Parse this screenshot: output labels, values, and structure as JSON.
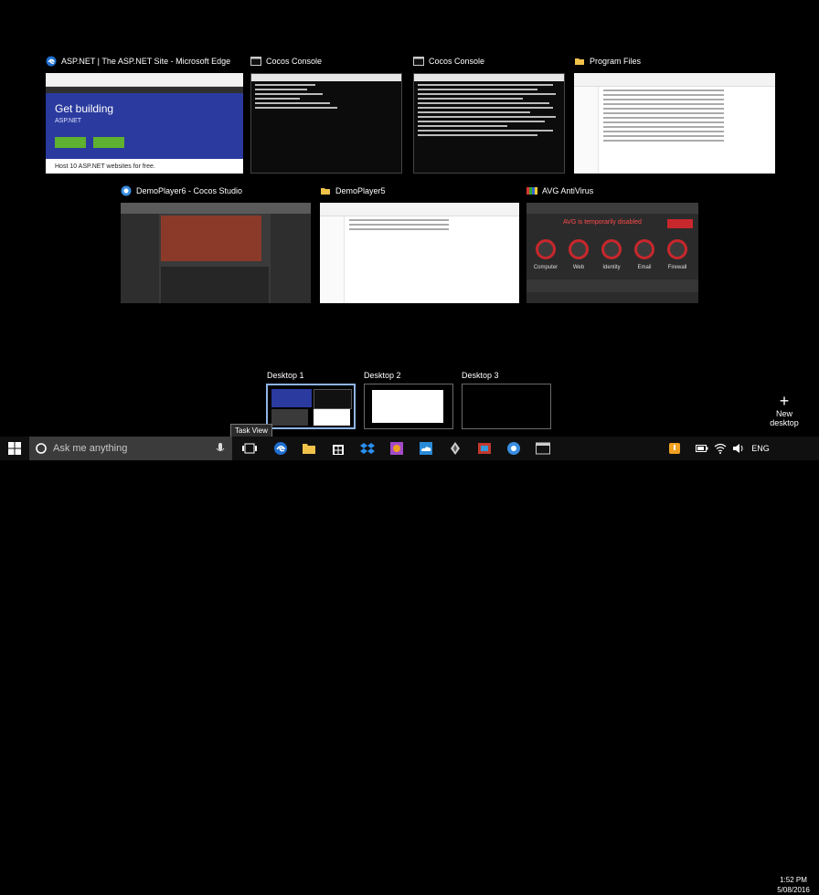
{
  "windows": [
    {
      "title": "ASP.NET | The ASP.NET Site - Microsoft Edge",
      "icon": "edge-icon",
      "thumb": {
        "hero_title": "Get building",
        "hero_subtitle": "ASP.NET",
        "footer_text": "Host 10 ASP.NET websites for free."
      }
    },
    {
      "title": "Cocos Console",
      "icon": "console-icon"
    },
    {
      "title": "Cocos Console",
      "icon": "console-icon"
    },
    {
      "title": "Program Files",
      "icon": "folder-icon"
    },
    {
      "title": "DemoPlayer6 - Cocos Studio",
      "icon": "cocos-studio-icon"
    },
    {
      "title": "DemoPlayer5",
      "icon": "folder-icon"
    },
    {
      "title": "AVG AntiVirus",
      "icon": "avg-icon",
      "thumb": {
        "alert": "AVG is temporarily disabled",
        "labels": [
          "Computer",
          "Web",
          "Identity",
          "Email",
          "Firewall"
        ]
      }
    }
  ],
  "desktops": [
    {
      "label": "Desktop 1",
      "selected": true
    },
    {
      "label": "Desktop 2",
      "selected": false
    },
    {
      "label": "Desktop 3",
      "selected": false
    }
  ],
  "new_desktop_label": "New desktop",
  "taskbar": {
    "search_placeholder": "Ask me anything",
    "tooltip": "Task View",
    "language": "ENG",
    "time": "1:52 PM",
    "date": "5/08/2016"
  },
  "colors": {
    "accent": "#8fb4e6",
    "taskbar": "#101010",
    "search": "#3b3b3b"
  }
}
